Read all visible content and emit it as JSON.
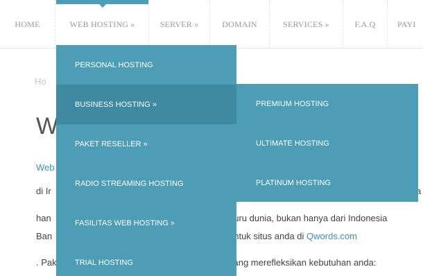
{
  "nav": {
    "items": [
      {
        "label": "HOME"
      },
      {
        "label": "WEB HOSTING »"
      },
      {
        "label": "SERVER »"
      },
      {
        "label": "DOMAIN"
      },
      {
        "label": "SERVICES »"
      },
      {
        "label": "F.A.Q"
      },
      {
        "label": "PAYI"
      }
    ],
    "active_index": 1,
    "accent_color": "#4d9db7"
  },
  "dropdown": {
    "items": [
      {
        "label": "PERSONAL HOSTING"
      },
      {
        "label": "BUSINESS HOSTING »"
      },
      {
        "label": "PAKET RESELLER »"
      },
      {
        "label": "RADIO STREAMING HOSTING"
      },
      {
        "label": "FASILITAS WEB HOSTING »"
      },
      {
        "label": "TRIAL HOSTING"
      }
    ],
    "active_index": 1,
    "bg_color": "#4d9db7",
    "active_color": "#3f8aa3"
  },
  "submenu": {
    "items": [
      {
        "label": "PREMIUM HOSTING"
      },
      {
        "label": "ULTIMATE HOSTING"
      },
      {
        "label": "PLATINUM HOSTING"
      }
    ]
  },
  "page": {
    "breadcrumb": "Ho",
    "title": "W",
    "intro_link": "Web",
    "line_a": "di Ir",
    "line_a_end": "a",
    "line_b": "han",
    "line_b_end": "guru dunia, bukan hanya dari Indonesia",
    "line_c": "Ban",
    "line_c_end_prefix": "untuk situs anda di ",
    "line_c_link": "Qwords.com",
    "line_d": ". Pak",
    "line_d_end": "yang merefleksikan kebutuhan anda:"
  }
}
